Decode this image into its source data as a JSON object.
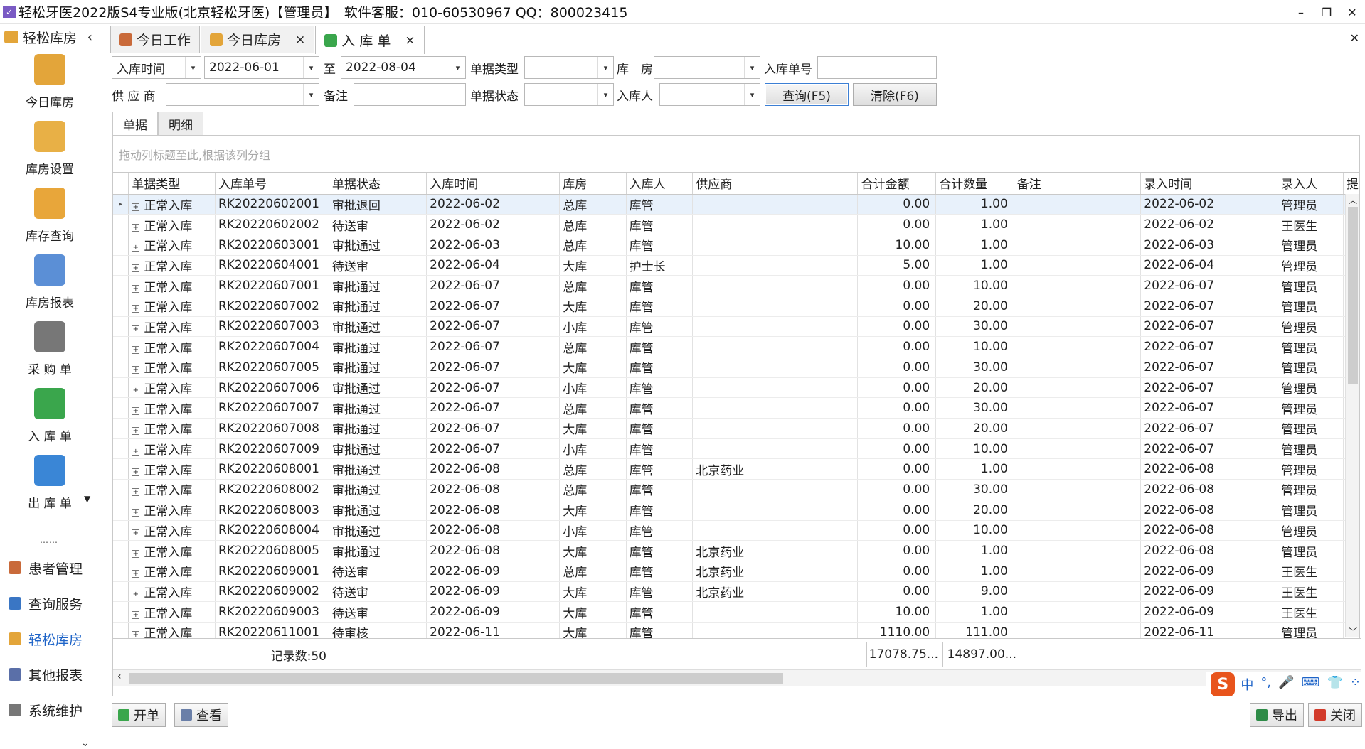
{
  "window": {
    "title": "轻松牙医2022版S4专业版(北京轻松牙医)【管理员】　软件客服：010-60530967 QQ：800023415",
    "minimize": "–",
    "restore": "❐",
    "close": "✕"
  },
  "sidebar": {
    "header": "轻松库房",
    "collapse": "‹",
    "tiles": [
      {
        "label": "今日库房",
        "color": "#e3a53a"
      },
      {
        "label": "库房设置",
        "color": "#e8b046"
      },
      {
        "label": "库存查询",
        "color": "#e8a63a"
      },
      {
        "label": "库房报表",
        "color": "#5b8fd6"
      },
      {
        "label": "采 购 单",
        "color": "#777"
      },
      {
        "label": "入 库 单",
        "color": "#3aa64c"
      },
      {
        "label": "出 库 单",
        "color": "#3a86d6"
      }
    ],
    "more": "▼",
    "dots": "……",
    "nav": [
      {
        "label": "患者管理",
        "color": "#c96a3a"
      },
      {
        "label": "查询服务",
        "color": "#3a76c4"
      },
      {
        "label": "轻松库房",
        "color": "#e3a53a"
      },
      {
        "label": "其他报表",
        "color": "#5a6fa8"
      },
      {
        "label": "系统维护",
        "color": "#777"
      }
    ],
    "bottom": "⌄"
  },
  "tabs": [
    {
      "label": "今日工作",
      "closable": false
    },
    {
      "label": "今日库房",
      "closable": true
    },
    {
      "label": "入 库 单",
      "closable": true
    }
  ],
  "tab_close": "×",
  "filters": {
    "date_field": "入库时间",
    "date_from": "2022-06-01",
    "to_label": "至",
    "date_to": "2022-08-04",
    "doc_type_label": "单据类型",
    "doc_type": "",
    "warehouse_label": "库　房",
    "warehouse": "",
    "order_no_label": "入库单号",
    "supplier_label": "供 应 商",
    "supplier": "",
    "remark_label": "备注",
    "status_label": "单据状态",
    "status": "",
    "receiver_label": "入库人",
    "receiver": "",
    "query_btn": "查询(F5)",
    "clear_btn": "清除(F6)"
  },
  "subtabs": [
    "单据",
    "明细"
  ],
  "group_hint": "拖动列标题至此,根据该列分组",
  "columns": [
    "单据类型",
    "入库单号",
    "单据状态",
    "入库时间",
    "库房",
    "入库人",
    "供应商",
    "合计金额",
    "合计数量",
    "备注",
    "录入时间",
    "录入人",
    "提"
  ],
  "rows": [
    [
      "正常入库",
      "RK20220602001",
      "审批退回",
      "2022-06-02",
      "总库",
      "库管",
      "",
      "0.00",
      "1.00",
      "",
      "2022-06-02",
      "管理员"
    ],
    [
      "正常入库",
      "RK20220602002",
      "待送审",
      "2022-06-02",
      "总库",
      "库管",
      "",
      "0.00",
      "1.00",
      "",
      "2022-06-02",
      "王医生"
    ],
    [
      "正常入库",
      "RK20220603001",
      "审批通过",
      "2022-06-03",
      "总库",
      "库管",
      "",
      "10.00",
      "1.00",
      "",
      "2022-06-03",
      "管理员"
    ],
    [
      "正常入库",
      "RK20220604001",
      "待送审",
      "2022-06-04",
      "大库",
      "护士长",
      "",
      "5.00",
      "1.00",
      "",
      "2022-06-04",
      "管理员"
    ],
    [
      "正常入库",
      "RK20220607001",
      "审批通过",
      "2022-06-07",
      "总库",
      "库管",
      "",
      "0.00",
      "10.00",
      "",
      "2022-06-07",
      "管理员"
    ],
    [
      "正常入库",
      "RK20220607002",
      "审批通过",
      "2022-06-07",
      "大库",
      "库管",
      "",
      "0.00",
      "20.00",
      "",
      "2022-06-07",
      "管理员"
    ],
    [
      "正常入库",
      "RK20220607003",
      "审批通过",
      "2022-06-07",
      "小库",
      "库管",
      "",
      "0.00",
      "30.00",
      "",
      "2022-06-07",
      "管理员"
    ],
    [
      "正常入库",
      "RK20220607004",
      "审批通过",
      "2022-06-07",
      "总库",
      "库管",
      "",
      "0.00",
      "10.00",
      "",
      "2022-06-07",
      "管理员"
    ],
    [
      "正常入库",
      "RK20220607005",
      "审批通过",
      "2022-06-07",
      "大库",
      "库管",
      "",
      "0.00",
      "30.00",
      "",
      "2022-06-07",
      "管理员"
    ],
    [
      "正常入库",
      "RK20220607006",
      "审批通过",
      "2022-06-07",
      "小库",
      "库管",
      "",
      "0.00",
      "20.00",
      "",
      "2022-06-07",
      "管理员"
    ],
    [
      "正常入库",
      "RK20220607007",
      "审批通过",
      "2022-06-07",
      "总库",
      "库管",
      "",
      "0.00",
      "30.00",
      "",
      "2022-06-07",
      "管理员"
    ],
    [
      "正常入库",
      "RK20220607008",
      "审批通过",
      "2022-06-07",
      "大库",
      "库管",
      "",
      "0.00",
      "20.00",
      "",
      "2022-06-07",
      "管理员"
    ],
    [
      "正常入库",
      "RK20220607009",
      "审批通过",
      "2022-06-07",
      "小库",
      "库管",
      "",
      "0.00",
      "10.00",
      "",
      "2022-06-07",
      "管理员"
    ],
    [
      "正常入库",
      "RK20220608001",
      "审批通过",
      "2022-06-08",
      "总库",
      "库管",
      "北京药业",
      "0.00",
      "1.00",
      "",
      "2022-06-08",
      "管理员"
    ],
    [
      "正常入库",
      "RK20220608002",
      "审批通过",
      "2022-06-08",
      "总库",
      "库管",
      "",
      "0.00",
      "30.00",
      "",
      "2022-06-08",
      "管理员"
    ],
    [
      "正常入库",
      "RK20220608003",
      "审批通过",
      "2022-06-08",
      "大库",
      "库管",
      "",
      "0.00",
      "20.00",
      "",
      "2022-06-08",
      "管理员"
    ],
    [
      "正常入库",
      "RK20220608004",
      "审批通过",
      "2022-06-08",
      "小库",
      "库管",
      "",
      "0.00",
      "10.00",
      "",
      "2022-06-08",
      "管理员"
    ],
    [
      "正常入库",
      "RK20220608005",
      "审批通过",
      "2022-06-08",
      "大库",
      "库管",
      "北京药业",
      "0.00",
      "1.00",
      "",
      "2022-06-08",
      "管理员"
    ],
    [
      "正常入库",
      "RK20220609001",
      "待送审",
      "2022-06-09",
      "总库",
      "库管",
      "北京药业",
      "0.00",
      "1.00",
      "",
      "2022-06-09",
      "王医生"
    ],
    [
      "正常入库",
      "RK20220609002",
      "待送审",
      "2022-06-09",
      "大库",
      "库管",
      "北京药业",
      "0.00",
      "9.00",
      "",
      "2022-06-09",
      "王医生"
    ],
    [
      "正常入库",
      "RK20220609003",
      "待送审",
      "2022-06-09",
      "大库",
      "库管",
      "",
      "10.00",
      "1.00",
      "",
      "2022-06-09",
      "王医生"
    ],
    [
      "正常入库",
      "RK20220611001",
      "待审核",
      "2022-06-11",
      "大库",
      "库管",
      "",
      "1110.00",
      "111.00",
      "",
      "2022-06-11",
      "管理员"
    ]
  ],
  "footer": {
    "record_count": "记录数:50",
    "sum_amount": "17078.75...",
    "sum_qty": "14897.00..."
  },
  "bottom_buttons": {
    "new": "开单",
    "view": "查看",
    "export": "导出",
    "close": "关闭"
  },
  "ime": {
    "logo": "S",
    "icons": [
      "中",
      "°,",
      "🎤",
      "⌨",
      "👕",
      "⁘"
    ]
  }
}
